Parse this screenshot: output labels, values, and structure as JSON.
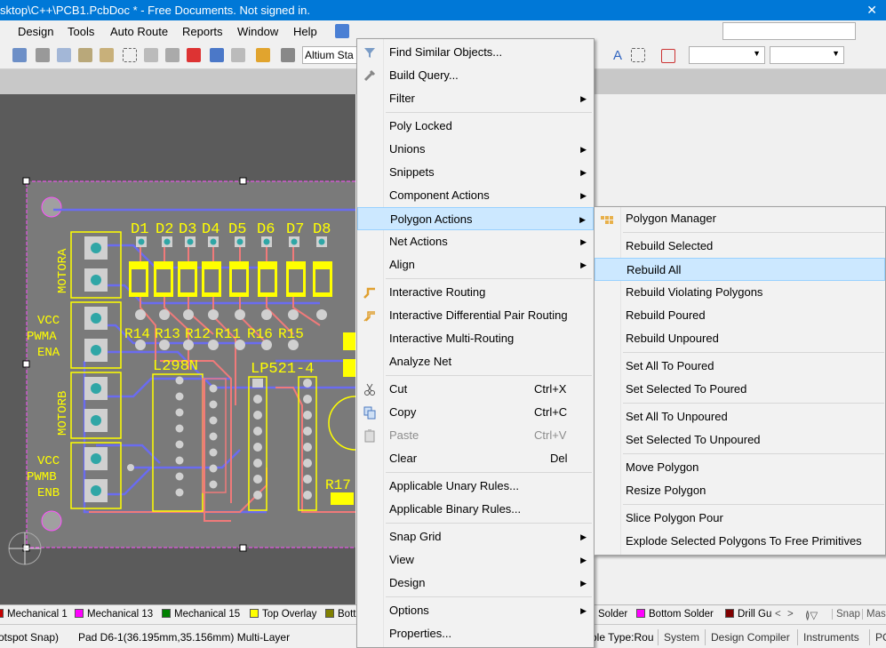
{
  "window": {
    "title": "sktop\\C++\\PCB1.PcbDoc * - Free Documents. Not signed in."
  },
  "menubar": {
    "items": [
      {
        "label": "Design"
      },
      {
        "label": "Tools"
      },
      {
        "label": "Auto Route"
      },
      {
        "label": "Reports"
      },
      {
        "label": "Window"
      },
      {
        "label": "Help"
      }
    ]
  },
  "toolbar": {
    "altium_box": "Altium Sta"
  },
  "pcb": {
    "designators": [
      "D1",
      "D2",
      "D3",
      "D4",
      "D5",
      "D6",
      "D7",
      "D8",
      "R14",
      "R13",
      "R12",
      "R11",
      "R16",
      "R15",
      "L298N",
      "LP521-4",
      "R17"
    ],
    "side_labels": [
      "MOTORA",
      "VCC",
      "PWMA",
      "ENA",
      "MOTORB",
      "VCC",
      "PWMB",
      "ENB"
    ],
    "colors": {
      "board": "#7a7a7a",
      "silk": "#ffff00",
      "track_bottom": "#6a6cf0",
      "track_top": "#f07a7a",
      "pad": "#d0d0d0",
      "outline": "#ff4fff",
      "background": "#5b5b5b"
    }
  },
  "context_menu": {
    "items": [
      {
        "label": "Find Similar Objects...",
        "icon": "find-similar-icon",
        "submenu": false
      },
      {
        "label": "Build Query...",
        "icon": "build-query-icon",
        "submenu": false
      },
      {
        "label": "Filter",
        "submenu": true
      },
      {
        "label": "Poly Locked",
        "submenu": false
      },
      {
        "label": "Unions",
        "submenu": true
      },
      {
        "label": "Snippets",
        "submenu": true
      },
      {
        "label": "Component Actions",
        "submenu": true
      },
      {
        "label": "Polygon Actions",
        "submenu": true,
        "highlighted": true
      },
      {
        "label": "Net Actions",
        "submenu": true
      },
      {
        "label": "Align",
        "submenu": true
      },
      {
        "label": "Interactive Routing",
        "icon": "interactive-routing-icon",
        "submenu": false
      },
      {
        "label": "Interactive Differential Pair Routing",
        "icon": "diff-pair-routing-icon",
        "submenu": false
      },
      {
        "label": "Interactive Multi-Routing",
        "submenu": false
      },
      {
        "label": "Analyze Net",
        "submenu": false
      },
      {
        "label": "Cut",
        "shortcut": "Ctrl+X",
        "icon": "cut-icon"
      },
      {
        "label": "Copy",
        "shortcut": "Ctrl+C",
        "icon": "copy-icon"
      },
      {
        "label": "Paste",
        "shortcut": "Ctrl+V",
        "icon": "paste-icon",
        "disabled": true
      },
      {
        "label": "Clear",
        "shortcut": "Del"
      },
      {
        "label": "Applicable Unary Rules..."
      },
      {
        "label": "Applicable Binary Rules..."
      },
      {
        "label": "Snap Grid",
        "submenu": true
      },
      {
        "label": "View",
        "submenu": true
      },
      {
        "label": "Design",
        "submenu": true
      },
      {
        "label": "Options",
        "submenu": true
      },
      {
        "label": "Properties..."
      }
    ]
  },
  "submenu": {
    "items": [
      {
        "label": "Polygon Manager",
        "icon": "polygon-manager-icon"
      },
      {
        "label": "Rebuild Selected"
      },
      {
        "label": "Rebuild All",
        "highlighted": true
      },
      {
        "label": "Rebuild Violating Polygons"
      },
      {
        "label": "Rebuild Poured"
      },
      {
        "label": "Rebuild Unpoured"
      },
      {
        "label": "Set All To Poured"
      },
      {
        "label": "Set Selected To Poured"
      },
      {
        "label": "Set All To Unpoured"
      },
      {
        "label": "Set Selected To Unpoured"
      },
      {
        "label": "Move Polygon"
      },
      {
        "label": "Resize Polygon"
      },
      {
        "label": "Slice Polygon Pour"
      },
      {
        "label": "Explode Selected Polygons To Free Primitives"
      }
    ]
  },
  "layers": [
    {
      "label": "Mechanical 1",
      "color": "#c80000"
    },
    {
      "label": "Mechanical 13",
      "color": "#ff00ff"
    },
    {
      "label": "Mechanical 15",
      "color": "#008000"
    },
    {
      "label": "Top Overlay",
      "color": "#ffff00"
    },
    {
      "label": "Bott",
      "color": "#808000"
    },
    {
      "label": "Solder",
      "color": ""
    },
    {
      "label": "Bottom Solder",
      "color": "#ff00ff"
    },
    {
      "label": "Drill Gu",
      "color": "#800000"
    }
  ],
  "layer_right": {
    "snap": "Snap",
    "mas": "Mas"
  },
  "status": {
    "snap": "otspot Snap)",
    "pad": "Pad D6-1(36.195mm,35.156mm)  Multi-Layer",
    "hole": "ole Type:Rou",
    "tabs": [
      "System",
      "Design Compiler",
      "Instruments",
      "PC"
    ]
  }
}
